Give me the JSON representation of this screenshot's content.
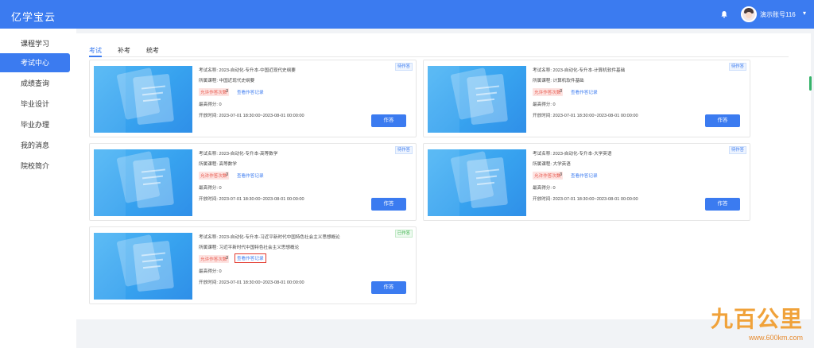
{
  "app": {
    "title": "亿学宝云"
  },
  "header": {
    "user_name": "演示账号116",
    "caret": "▾"
  },
  "sidebar": {
    "items": [
      {
        "label": "课程学习",
        "active": false
      },
      {
        "label": "考试中心",
        "active": true
      },
      {
        "label": "成绩查询",
        "active": false
      },
      {
        "label": "毕业设计",
        "active": false
      },
      {
        "label": "毕业办理",
        "active": false
      },
      {
        "label": "我的消息",
        "active": false
      },
      {
        "label": "院校简介",
        "active": false
      }
    ]
  },
  "tabs": [
    {
      "label": "考试",
      "active": true
    },
    {
      "label": "补考",
      "active": false
    },
    {
      "label": "统考",
      "active": false
    }
  ],
  "labels": {
    "exam_name": "考试名称: ",
    "course": "所属课程: ",
    "allow_times": "允许作答次数",
    "view_records": "查看作答记录",
    "best_score": "最高得分: ",
    "open_time": "开放时间: ",
    "answer_btn": "作答"
  },
  "cards": [
    {
      "exam_name": "2023-自动化-专升本-中国近现代史纲要",
      "course": "中国近现代史纲要",
      "allow_count": "3",
      "best_score": "0",
      "open_time": "2023-07-01 18:30:00~2023-08-01 00:00:00",
      "status": "待作答"
    },
    {
      "exam_name": "2023-自动化-专升本-计算机软件基础",
      "course": "计算机软件基础",
      "allow_count": "3",
      "best_score": "0",
      "open_time": "2023-07-01 18:30:00~2023-08-01 00:00:00",
      "status": "待作答"
    },
    {
      "exam_name": "2023-自动化-专升本-高等数学",
      "course": "高等数学",
      "allow_count": "3",
      "best_score": "0",
      "open_time": "2023-07-01 18:30:00~2023-08-01 00:00:00",
      "status": "待作答"
    },
    {
      "exam_name": "2023-自动化-专升本-大学英语",
      "course": "大学英语",
      "allow_count": "3",
      "best_score": "0",
      "open_time": "2023-07-01 18:30:00~2023-08-01 00:00:00",
      "status": "待作答"
    },
    {
      "exam_name": "2023-自动化-专升本-习近平新时代中国特色社会主义思想概论",
      "course": "习近平新时代中国特色社会主义思想概论",
      "allow_count": "3",
      "best_score": "0",
      "open_time": "2023-07-01 18:30:00~2023-08-01 00:00:00",
      "status": "已作答"
    }
  ],
  "watermark": {
    "brand": "九百公里",
    "url": "www.600km.com"
  },
  "colors": {
    "primary": "#3b7bf0",
    "allow_tag_bg": "#fde3e1",
    "allow_tag_text": "#e85a4f",
    "done": "#3bb24a",
    "highlight": "#e33a2f"
  },
  "icons": {
    "bell": "bell-icon",
    "avatar": "user-avatar"
  }
}
